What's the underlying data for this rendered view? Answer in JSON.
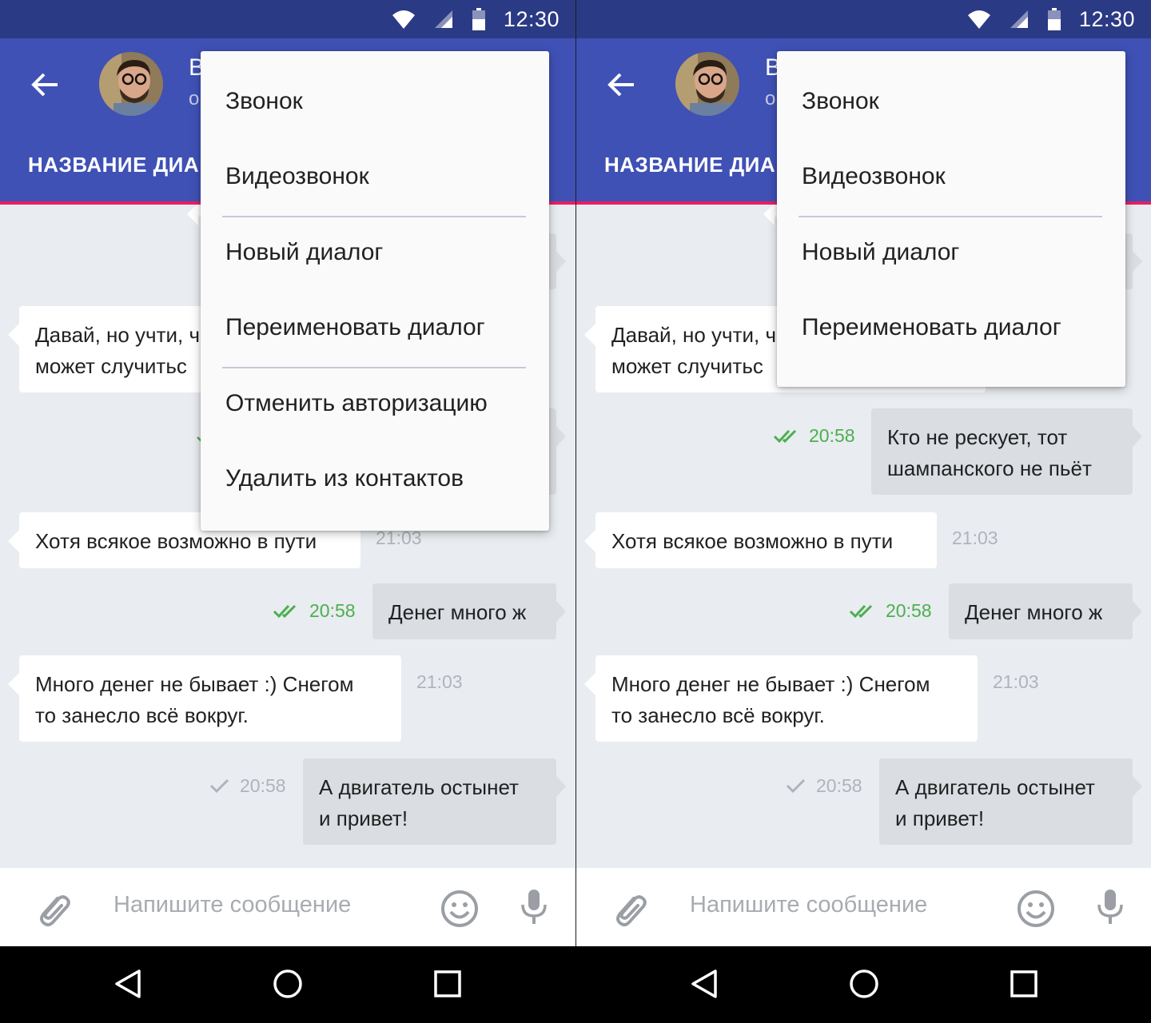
{
  "status_bar": {
    "time": "12:30"
  },
  "app_bar": {
    "contact_name": "В",
    "contact_status": "о",
    "tab_title": "НАЗВАНИЕ ДИА"
  },
  "left_screen": {
    "messages": [
      {
        "kind": "in",
        "line1": "Давай, но учти, ч",
        "line2": "может случитьс"
      },
      {
        "kind": "in",
        "line1": "Хотя всякое возможно в пути",
        "time": "21:03"
      },
      {
        "kind": "out",
        "line1": "Денег много ж",
        "time": "20:58",
        "status": "read"
      },
      {
        "kind": "in",
        "line1": "Много денег не бывает :)  Снегом",
        "line2": "то занесло всё вокруг.",
        "time": "21:03"
      },
      {
        "kind": "out",
        "line1": "А двигатель остынет",
        "line2": "и привет!",
        "time": "20:58",
        "status": "sent"
      }
    ],
    "menu": [
      {
        "label": "Звонок"
      },
      {
        "label": "Видеозвонок"
      },
      {
        "label": "Новый диалог"
      },
      {
        "label": "Переименовать диалог"
      },
      {
        "label": "Отменить авторизацию"
      },
      {
        "label": "Удалить из контактов"
      }
    ]
  },
  "right_screen": {
    "messages": [
      {
        "kind": "in",
        "line1": "Давай, но учти, ч",
        "line2": "может случитьс"
      },
      {
        "kind": "out",
        "line1": "Кто не рескует, тот",
        "line2": "шампанского не пьёт",
        "time": "20:58",
        "status": "read"
      },
      {
        "kind": "in",
        "line1": "Хотя всякое возможно в пути",
        "time": "21:03"
      },
      {
        "kind": "out",
        "line1": "Денег много ж",
        "time": "20:58",
        "status": "read"
      },
      {
        "kind": "in",
        "line1": "Много денег не бывает :)  Снегом",
        "line2": "то занесло всё вокруг.",
        "time": "21:03"
      },
      {
        "kind": "out",
        "line1": "А двигатель остынет",
        "line2": "и привет!",
        "time": "20:58",
        "status": "sent"
      }
    ],
    "menu": [
      {
        "label": "Звонок"
      },
      {
        "label": "Видеозвонок"
      },
      {
        "label": "Новый диалог"
      },
      {
        "label": "Переименовать диалог"
      }
    ]
  },
  "input": {
    "placeholder": "Напишите сообщение"
  },
  "icons": {
    "back": "arrow-left-icon",
    "attach": "paperclip-icon",
    "emoji": "smiley-icon",
    "mic": "microphone-icon",
    "wifi": "wifi-icon",
    "signal": "signal-icon",
    "battery": "battery-icon",
    "nav_back": "triangle-back-icon",
    "nav_home": "circle-home-icon",
    "nav_recent": "square-recent-icon"
  },
  "colors": {
    "status_bar": "#2b3a84",
    "app_bar": "#3f51b5",
    "accent": "#e91e63",
    "chat_bg": "#e9ecf0",
    "outgoing_bubble": "#dadde2",
    "read_green": "#4caf50"
  }
}
